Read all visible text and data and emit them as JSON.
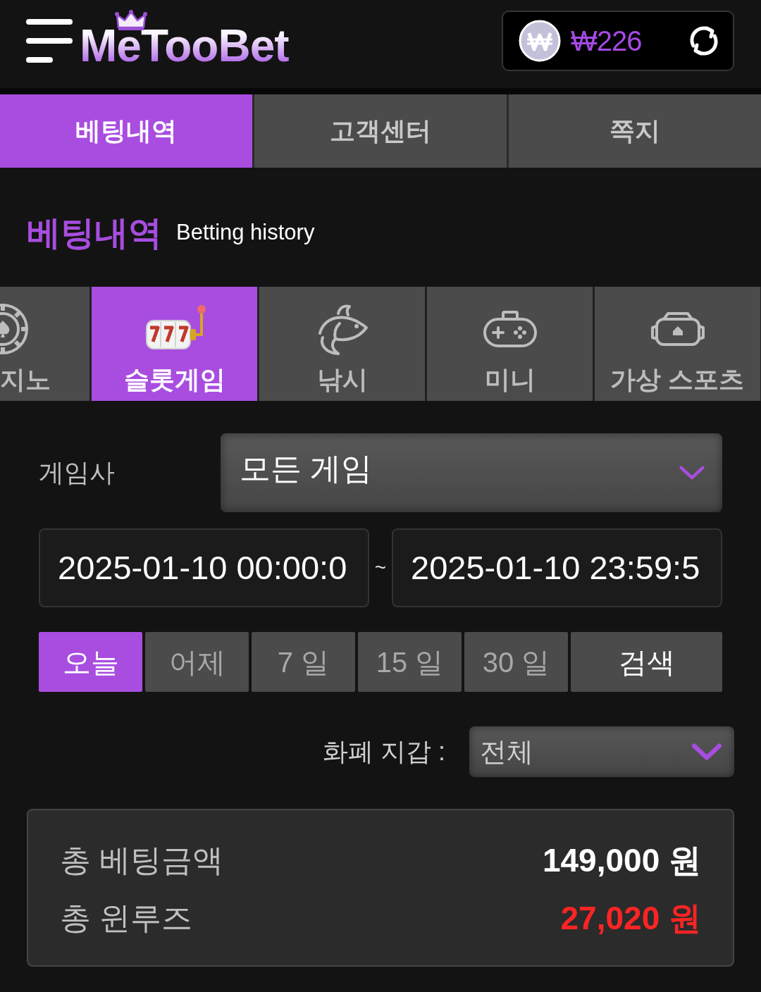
{
  "header": {
    "logo": "MeTooBet",
    "balance": "₩226"
  },
  "nav_tabs": [
    {
      "label": "베팅내역",
      "selected": true
    },
    {
      "label": "고객센터",
      "selected": false
    },
    {
      "label": "쪽지",
      "selected": false
    }
  ],
  "heading": {
    "title": "베팅내역",
    "subtitle": "Betting history"
  },
  "categories": [
    {
      "label": "지노",
      "kind": "chip",
      "selected": false
    },
    {
      "label": "슬롯게임",
      "kind": "slot",
      "selected": true
    },
    {
      "label": "낚시",
      "kind": "fish",
      "selected": false
    },
    {
      "label": "미니",
      "kind": "gamepad",
      "selected": false
    },
    {
      "label": "가상 스포츠",
      "kind": "vr",
      "selected": false
    }
  ],
  "filters": {
    "provider_label": "게임사",
    "provider_value": "모든 게임",
    "date_from": "2025-01-10 00:00:0",
    "date_separator": "~",
    "date_to": "2025-01-10 23:59:5",
    "periods": [
      {
        "label": "오늘",
        "selected": true
      },
      {
        "label": "어제",
        "selected": false
      },
      {
        "label": "7 일",
        "selected": false
      },
      {
        "label": "15 일",
        "selected": false
      },
      {
        "label": "30 일",
        "selected": false
      }
    ],
    "search_button": "검색",
    "wallet_label": "화폐 지갑 :",
    "wallet_value": "전체"
  },
  "summary": [
    {
      "label": "총 베팅금액",
      "value": "149,000 원",
      "color": "#ffffff"
    },
    {
      "label": "총 윈루즈",
      "value": "27,020 원",
      "color": "#ff2424"
    }
  ]
}
